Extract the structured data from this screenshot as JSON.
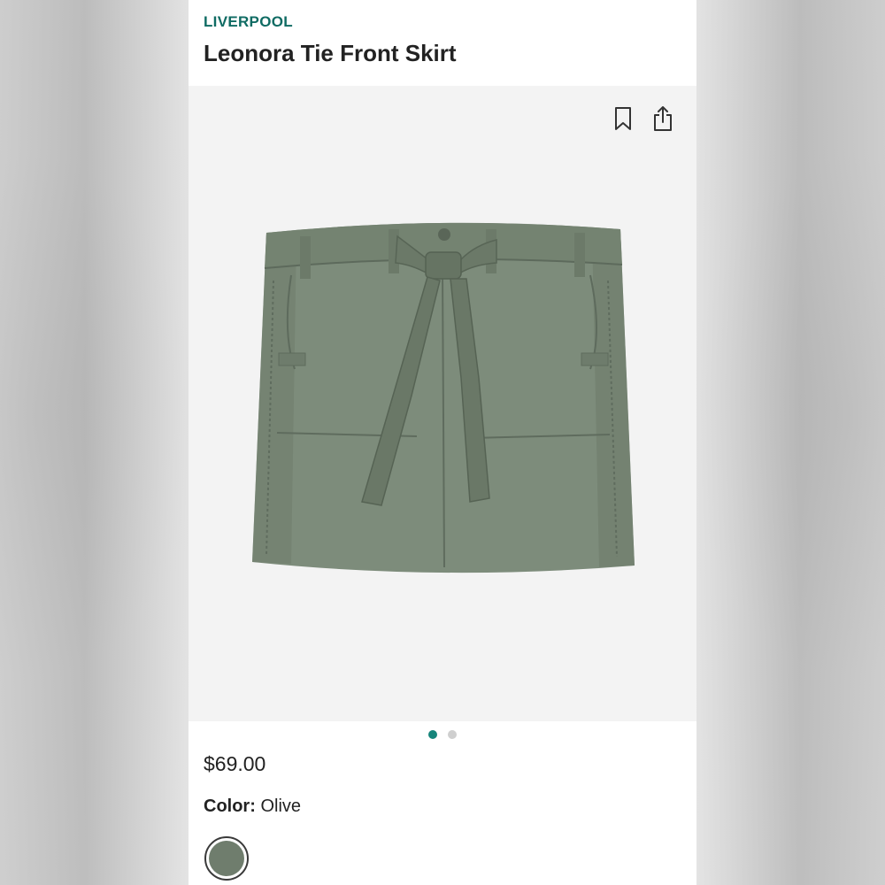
{
  "brand": "LIVERPOOL",
  "product": {
    "title": "Leonora Tie Front Skirt",
    "price": "$69.00",
    "color_label": "Color:",
    "color_value": "Olive"
  },
  "gallery": {
    "image_icon": "olive-tie-front-skirt-photo",
    "actions": [
      "bookmark-icon",
      "share-icon"
    ],
    "page_count": 2,
    "active_page": 1
  },
  "swatches": [
    {
      "name": "Olive",
      "hex": "#6f7d6d",
      "selected": true
    }
  ],
  "colors": {
    "brand": "#0f6b63",
    "active_dot": "#16857b",
    "inactive_dot": "#cfcfcf",
    "gallery_bg": "#f3f3f3"
  }
}
